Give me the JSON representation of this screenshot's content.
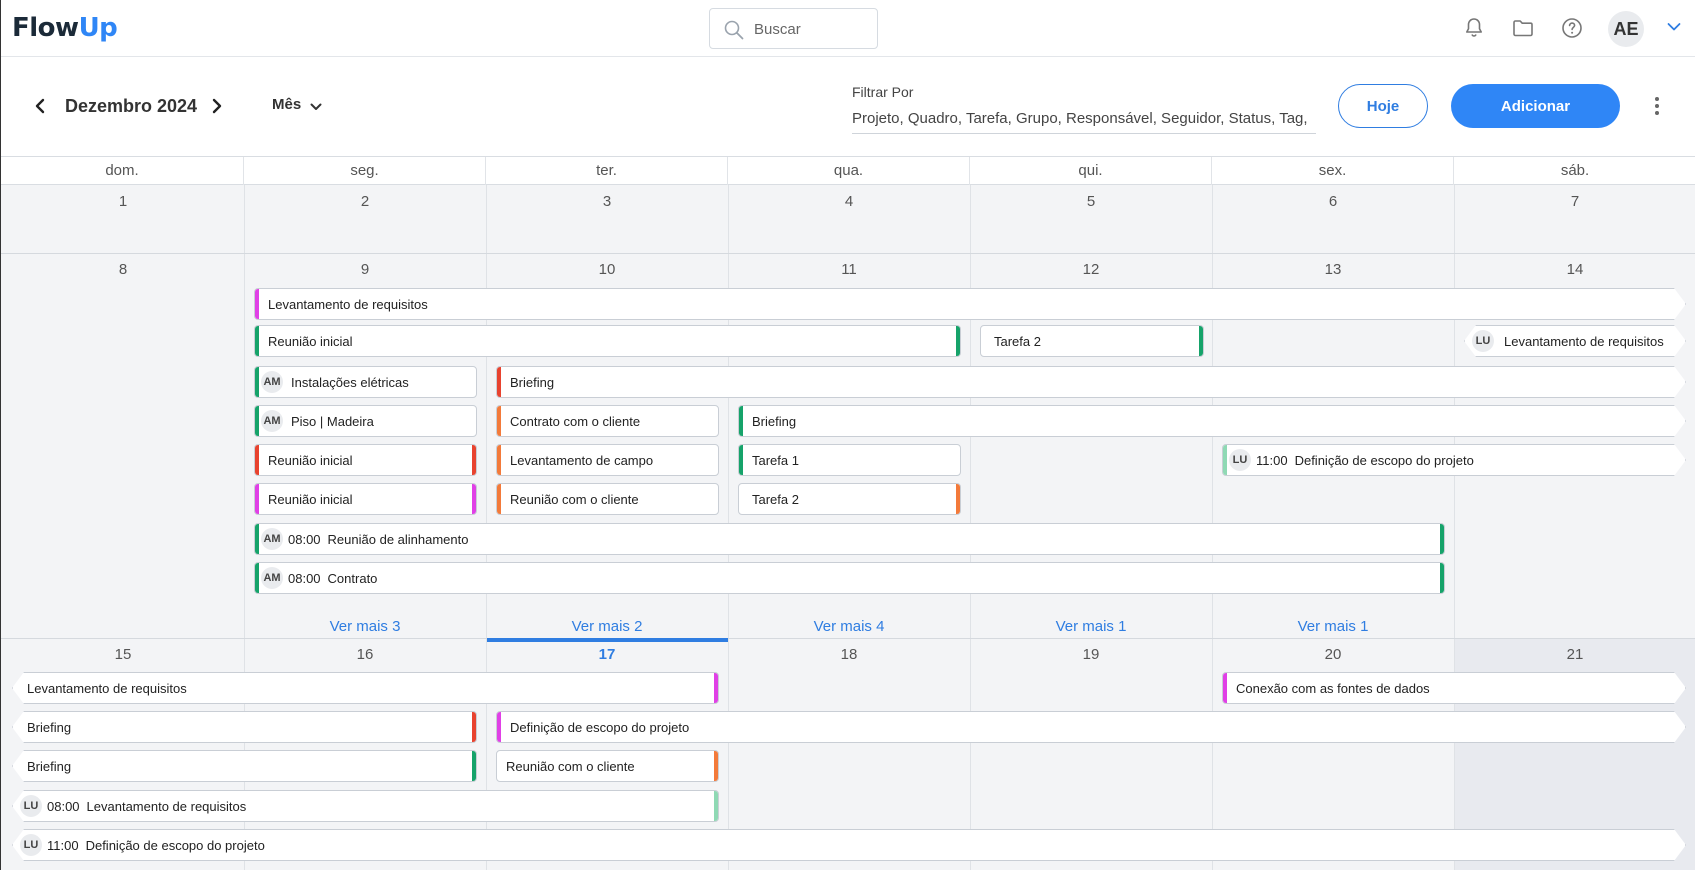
{
  "header": {
    "logo_part1": "Flow",
    "logo_part2": "Up",
    "search_placeholder": "Buscar",
    "user_initials": "AE"
  },
  "toolbar": {
    "month_title": "Dezembro 2024",
    "view_label": "Mês",
    "filter_label": "Filtrar Por",
    "filter_value": "Projeto, Quadro, Tarefa, Grupo, Responsável, Seguidor, Status, Tag,",
    "today_label": "Hoje",
    "add_label": "Adicionar"
  },
  "calendar": {
    "weekdays": [
      "dom.",
      "seg.",
      "ter.",
      "qua.",
      "qui.",
      "sex.",
      "sáb."
    ],
    "week1": [
      "1",
      "2",
      "3",
      "4",
      "5",
      "6",
      "7"
    ],
    "week2": [
      "8",
      "9",
      "10",
      "11",
      "12",
      "13",
      "14"
    ],
    "week3": [
      "15",
      "16",
      "17",
      "18",
      "19",
      "20",
      "21"
    ],
    "today": "17",
    "see_more": [
      "Ver mais 3",
      "Ver mais 2",
      "Ver mais 4",
      "Ver mais 1",
      "Ver mais 1"
    ],
    "colors": {
      "magenta": "#e040e6",
      "green": "#16a36a",
      "red": "#e8432f",
      "orange": "#f37a3a",
      "mint": "#8fd9b4",
      "accent": "#2f86f6"
    },
    "events": [
      {
        "title": "Levantamento de requisitos"
      },
      {
        "title": "Reunião inicial"
      },
      {
        "title": "Tarefa 2"
      },
      {
        "initials": "LU",
        "title": "Levantamento de requisitos"
      },
      {
        "initials": "AM",
        "title": "Instalações elétricas"
      },
      {
        "title": "Briefing"
      },
      {
        "initials": "AM",
        "title": "Piso | Madeira"
      },
      {
        "title": "Contrato com o cliente"
      },
      {
        "title": "Briefing"
      },
      {
        "title": "Reunião inicial"
      },
      {
        "title": "Levantamento de campo"
      },
      {
        "title": "Tarefa 1"
      },
      {
        "initials": "LU",
        "time": "11:00",
        "title": "Definição de escopo do projeto"
      },
      {
        "title": "Reunião inicial"
      },
      {
        "title": "Reunião com o cliente"
      },
      {
        "title": "Tarefa 2"
      },
      {
        "initials": "AM",
        "time": "08:00",
        "title": "Reunião de alinhamento"
      },
      {
        "initials": "AM",
        "time": "08:00",
        "title": "Contrato"
      },
      {
        "title": "Levantamento de requisitos"
      },
      {
        "title": "Conexão com as fontes de dados"
      },
      {
        "title": "Briefing"
      },
      {
        "title": "Definição de escopo do projeto"
      },
      {
        "title": "Briefing"
      },
      {
        "title": "Reunião com o cliente"
      },
      {
        "initials": "LU",
        "time": "08:00",
        "title": "Levantamento de requisitos"
      },
      {
        "initials": "LU",
        "time": "11:00",
        "title": "Definição de escopo do projeto"
      }
    ]
  }
}
